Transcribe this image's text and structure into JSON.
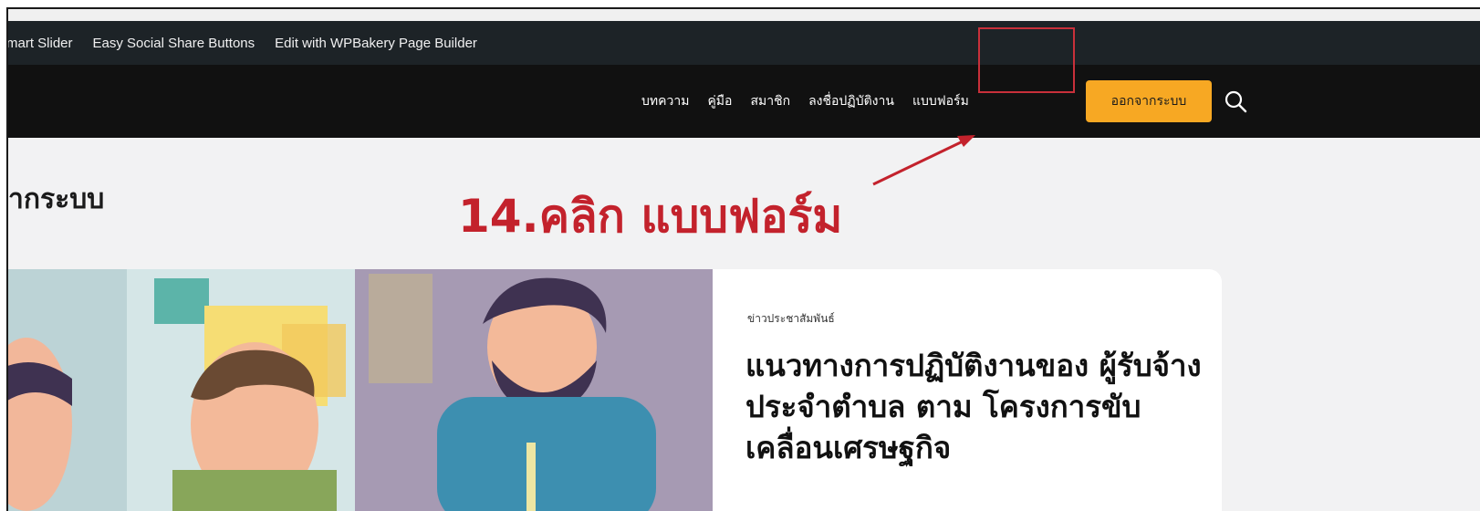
{
  "admin_bar": {
    "items": [
      "mart Slider",
      "Easy Social Share Buttons",
      "Edit with WPBakery Page Builder"
    ]
  },
  "nav": {
    "items": [
      "บทความ",
      "คู่มือ",
      "สมาชิก",
      "ลงชื่อปฏิบัติงาน",
      "แบบฟอร์ม"
    ],
    "logout_label": "ออกจากระบบ",
    "accent": "#f7a823"
  },
  "page": {
    "title": "ากระบบ"
  },
  "annotation": {
    "text": "14.คลิก แบบฟอร์ม",
    "color": "#c3222c"
  },
  "article": {
    "category": "ข่าวประชาสัมพันธ์",
    "title": "แนวทางการปฏิบัติงานของ ผู้รับจ้างประจำตำบล ตาม โครงการขับเคลื่อนเศรษฐกิจ"
  }
}
